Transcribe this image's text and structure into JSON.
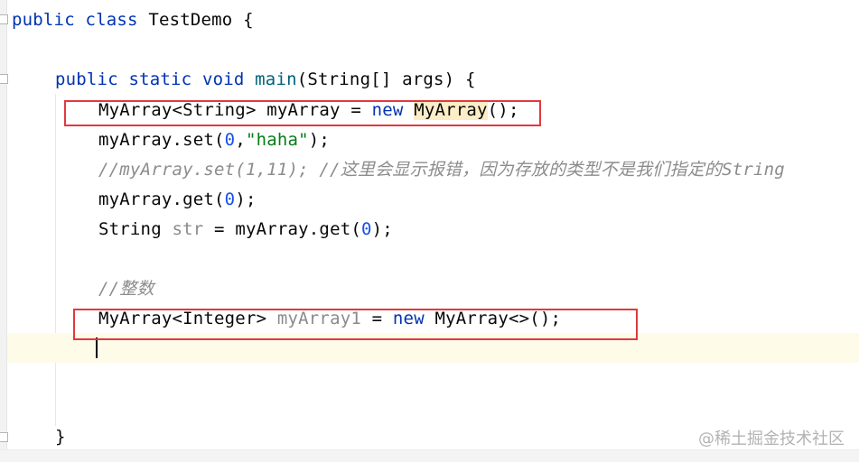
{
  "lines": {
    "l1": [
      "public",
      "class",
      "TestDemo {"
    ],
    "l2": [
      "public",
      "static",
      "void",
      "main",
      "(String[] args) {"
    ],
    "l3": [
      "MyArray<String> myArray = ",
      "new",
      "MyArray",
      "();"
    ],
    "l4": [
      "myArray.set(",
      "0",
      ",",
      "\"haha\"",
      ");"
    ],
    "l5": "//myArray.set(1,11); //这里会显示报错，因为存放的类型不是我们指定的String",
    "l6": [
      "myArray.get(",
      "0",
      ");"
    ],
    "l7": [
      "String ",
      "str",
      " = myArray.get(",
      "0",
      ");"
    ],
    "l8": "//整数",
    "l9": [
      "MyArray<Integer> ",
      "myArray1",
      " = ",
      "new",
      " MyArray<>();"
    ],
    "l10": "}"
  },
  "watermark": "@稀土掘金技术社区",
  "colors": {
    "keyword": "#0033b3",
    "method": "#00627a",
    "string": "#067d17",
    "number": "#1750eb",
    "comment": "#8c8c8c",
    "annotation_box": "#e0393e",
    "usage_highlight": "#fcedc7"
  }
}
